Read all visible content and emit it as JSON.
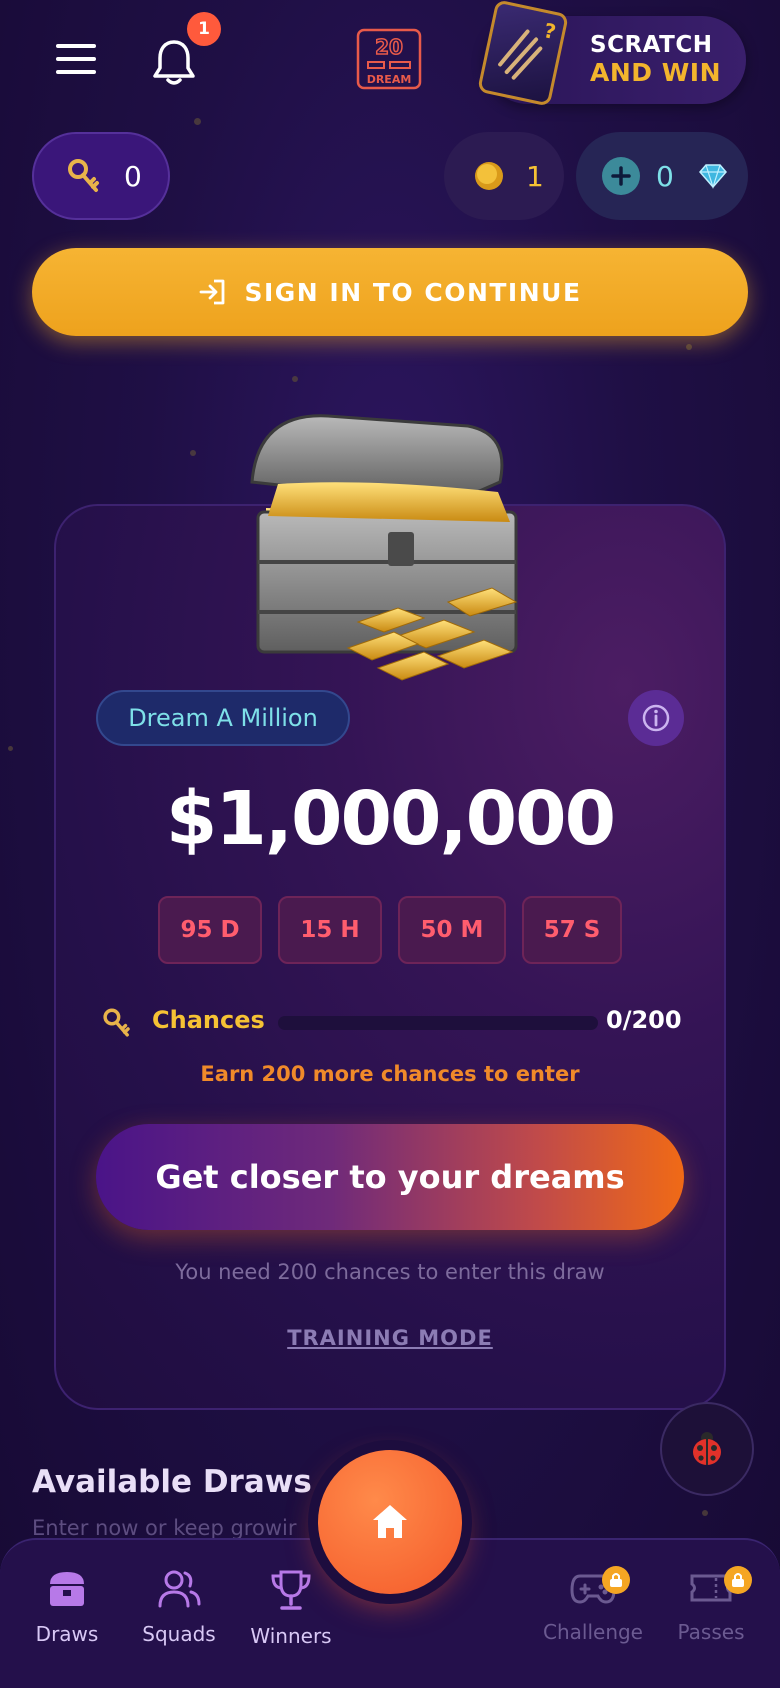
{
  "header": {
    "notification_count": "1",
    "logo_text": "20 DREAM",
    "scratch_line1": "SCRATCH",
    "scratch_line2": "AND WIN"
  },
  "wallet": {
    "keys": "0",
    "coins": "1",
    "gems": "0"
  },
  "signin": {
    "label": "SIGN IN TO CONTINUE"
  },
  "draw_card": {
    "tag": "Dream A Million",
    "prize": "$1,000,000",
    "countdown": [
      {
        "label": "95 D"
      },
      {
        "label": "15 H"
      },
      {
        "label": "50 M"
      },
      {
        "label": "57 S"
      }
    ],
    "chances_label": "Chances",
    "chances_value": "0/200",
    "chances_progress": 0,
    "earn_text": "Earn 200 more chances to enter",
    "cta_label": "Get closer to your dreams",
    "need_text": "You need 200 chances to enter this draw",
    "training_label": "TRAINING MODE"
  },
  "available": {
    "title": "Available Draws",
    "subtitle": "Enter now or keep growir"
  },
  "nav": {
    "items": [
      {
        "label": "Draws"
      },
      {
        "label": "Squads"
      },
      {
        "label": "Winners"
      },
      {
        "label": "Challenge"
      },
      {
        "label": "Passes"
      }
    ]
  },
  "colors": {
    "accent_gold": "#f6b433",
    "accent_orange": "#f45a2a",
    "timer_red": "#ff5d6e",
    "teal": "#7ee0e8"
  }
}
